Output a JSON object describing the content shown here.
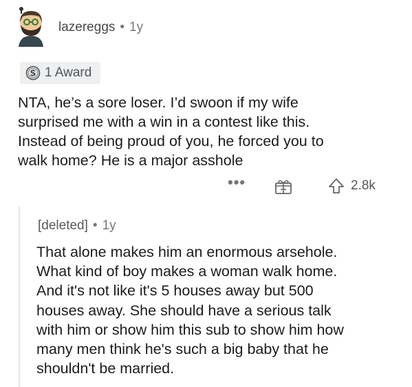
{
  "comment": {
    "username": "lazereggs",
    "separator": "•",
    "age": "1y",
    "award_label": "1 Award",
    "award_icon": "silver-award-icon",
    "body_lines": [
      "NTA, he’s a sore loser. I’d swoon if my wife",
      "surprised me with a win in a contest like this.",
      "Instead of being proud of you, he forced you to",
      "walk home? He is a major asshole"
    ],
    "actions": {
      "more_label": "•••",
      "gift_icon": "gift-icon",
      "upvote_icon": "upvote-arrow-icon",
      "score": "2.8k"
    }
  },
  "reply": {
    "username": "[deleted]",
    "separator": "•",
    "age": "1y",
    "body_lines": [
      "That alone makes him an enormous arsehole.",
      "What kind of boy makes a woman walk home.",
      "And it's not like it's 5 houses away but 500",
      "houses away. She should have a serious talk",
      "with him or show him this sub to show him how",
      "many men think he's such a big baby that he",
      "shouldn't be married."
    ]
  },
  "colors": {
    "text": "#1c1c1c",
    "meta": "#777777",
    "award_bg": "#edeff1",
    "thread_line": "#e3e5e8"
  }
}
